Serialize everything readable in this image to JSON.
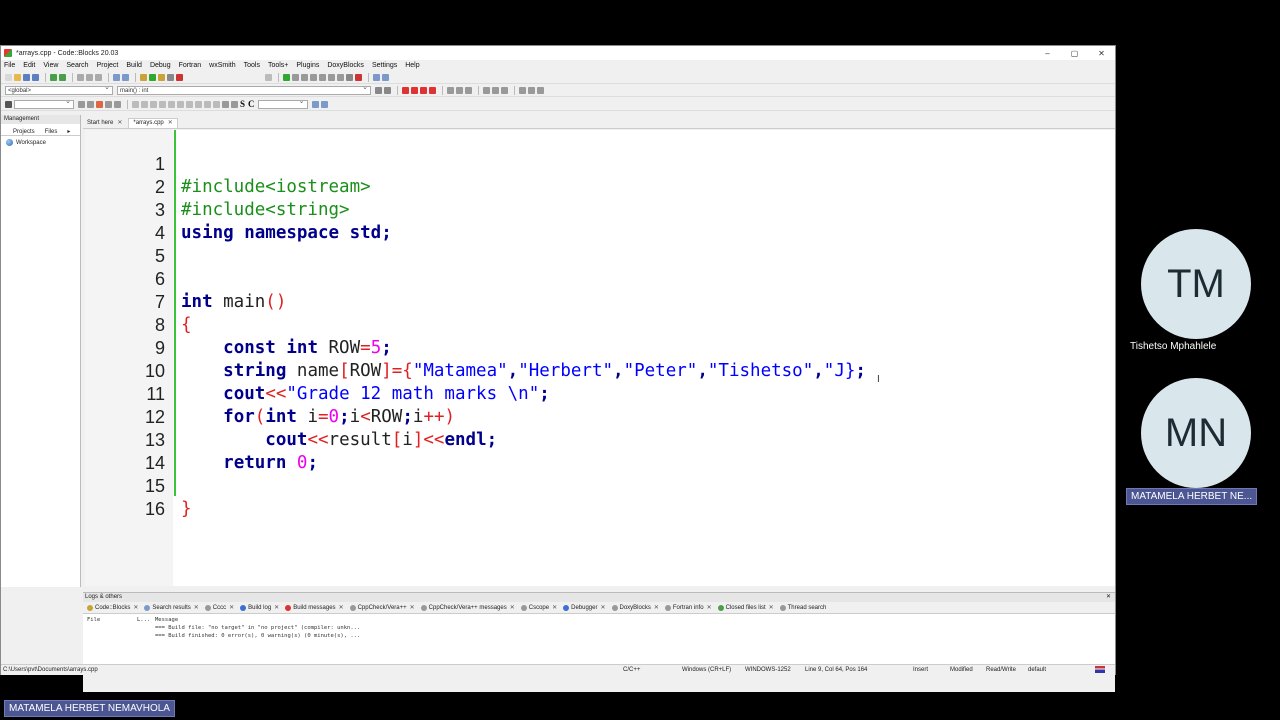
{
  "window": {
    "title": "*arrays.cpp - Code::Blocks 20.03",
    "controls": [
      "–",
      "▢",
      "✕"
    ]
  },
  "menubar": [
    "File",
    "Edit",
    "View",
    "Search",
    "Project",
    "Build",
    "Debug",
    "Fortran",
    "wxSmith",
    "Tools",
    "Tools+",
    "Plugins",
    "DoxyBlocks",
    "Settings",
    "Help"
  ],
  "scope_bar": {
    "scope": "<global>",
    "function": "main() : int"
  },
  "toolbar3_letters": [
    "S",
    "C"
  ],
  "management": {
    "header": "Management",
    "tabs": [
      "Projects",
      "Files"
    ],
    "workspace": "Workspace"
  },
  "editor_tabs": [
    {
      "label": "Start here",
      "close": "✕"
    },
    {
      "label": "*arrays.cpp",
      "close": "✕"
    }
  ],
  "code_lines": [
    {
      "n": "1"
    },
    {
      "n": "2"
    },
    {
      "n": "3"
    },
    {
      "n": "4"
    },
    {
      "n": "5"
    },
    {
      "n": "6"
    },
    {
      "n": "7"
    },
    {
      "n": "8"
    },
    {
      "n": "9"
    },
    {
      "n": "10"
    },
    {
      "n": "11"
    },
    {
      "n": "12"
    },
    {
      "n": "13"
    },
    {
      "n": "14"
    },
    {
      "n": "15"
    },
    {
      "n": "16"
    }
  ],
  "code_tokens": {
    "l1": "#include<iostream>",
    "l2": "#include<string>",
    "l3_kw": "using namespace std",
    "l3_semi": ";",
    "l6_kw": "int",
    "l6_id": " main",
    "l6_paren": "()",
    "l7": "{",
    "l8_kw": "const int",
    "l8_id": " ROW",
    "l8_eq": "=",
    "l8_num": "5",
    "l8_semi": ";",
    "l9_kw": "string",
    "l9_id": " name",
    "l9_op1": "[",
    "l9_row": "ROW",
    "l9_op2": "]={",
    "l9_s1": "\"Matamea\"",
    "l9_c1": ",",
    "l9_s2": "\"Herbert\"",
    "l9_c2": ",",
    "l9_s3": "\"Peter\"",
    "l9_c3": ",",
    "l9_s4": "\"Tishetso\"",
    "l9_c4": ",",
    "l9_s5": "\"J}",
    "l9_semi": ";",
    "l10_kw": "cout",
    "l10_op": "<<",
    "l10_str": "\"Grade 12 math marks \\n\"",
    "l10_semi": ";",
    "l11_kw": "for",
    "l11_p1": "(",
    "l11_kw2": "int",
    "l11_id1": " i",
    "l11_eq": "=",
    "l11_num": "0",
    "l11_semi1": ";",
    "l11_id2": "i",
    "l11_lt": "<",
    "l11_id3": "ROW",
    "l11_semi2": ";",
    "l11_id4": "i",
    "l11_inc": "++)",
    "l12_kw": "cout",
    "l12_op1": "<<",
    "l12_id": "result",
    "l12_b1": "[",
    "l12_i": "i",
    "l12_b2": "]",
    "l12_op2": "<<",
    "l12_kw2": "endl",
    "l12_semi": ";",
    "l13_kw": "return",
    "l13_num": " 0",
    "l13_semi": ";",
    "l15": "}"
  },
  "logs": {
    "header": "Logs & others",
    "close": "✕",
    "tabs": [
      "Code::Blocks",
      "Search results",
      "Cccc",
      "Build log",
      "Build messages",
      "CppCheck/Vera++",
      "CppCheck/Vera++ messages",
      "Cscope",
      "Debugger",
      "DoxyBlocks",
      "Fortran info",
      "Closed files list",
      "Thread search"
    ],
    "tab_close": "✕",
    "columns": [
      "File",
      "L...",
      "Message"
    ],
    "rows": [
      "=== Build file: \"no target\" in \"no project\" (compiler: unkn...",
      "=== Build finished: 0 error(s), 0 warning(s) (0 minute(s), ..."
    ]
  },
  "statusbar": {
    "path": "C:\\Users\\pvt\\Documents\\arrays.cpp",
    "lang": "C/C++",
    "eol": "Windows (CR+LF)",
    "encoding": "WINDOWS-1252",
    "position": "Line 9, Col 64, Pos 164",
    "mode": "Insert",
    "modified": "Modified",
    "rw": "Read/Write",
    "profile": "default"
  },
  "participants": [
    {
      "initials": "TM",
      "name": "Tishetso Mphahlele"
    },
    {
      "initials": "MN",
      "name": "MATAMELA HERBET NE..."
    }
  ],
  "self_label": "MATAMELA HERBET NEMAVHOLA",
  "colors": {
    "keyword": "#00008b",
    "preprocessor": "#1a8f1a",
    "string": "#0000ff",
    "number": "#f000f0",
    "operator": "#e02020",
    "participant_label": "#4b5693"
  }
}
